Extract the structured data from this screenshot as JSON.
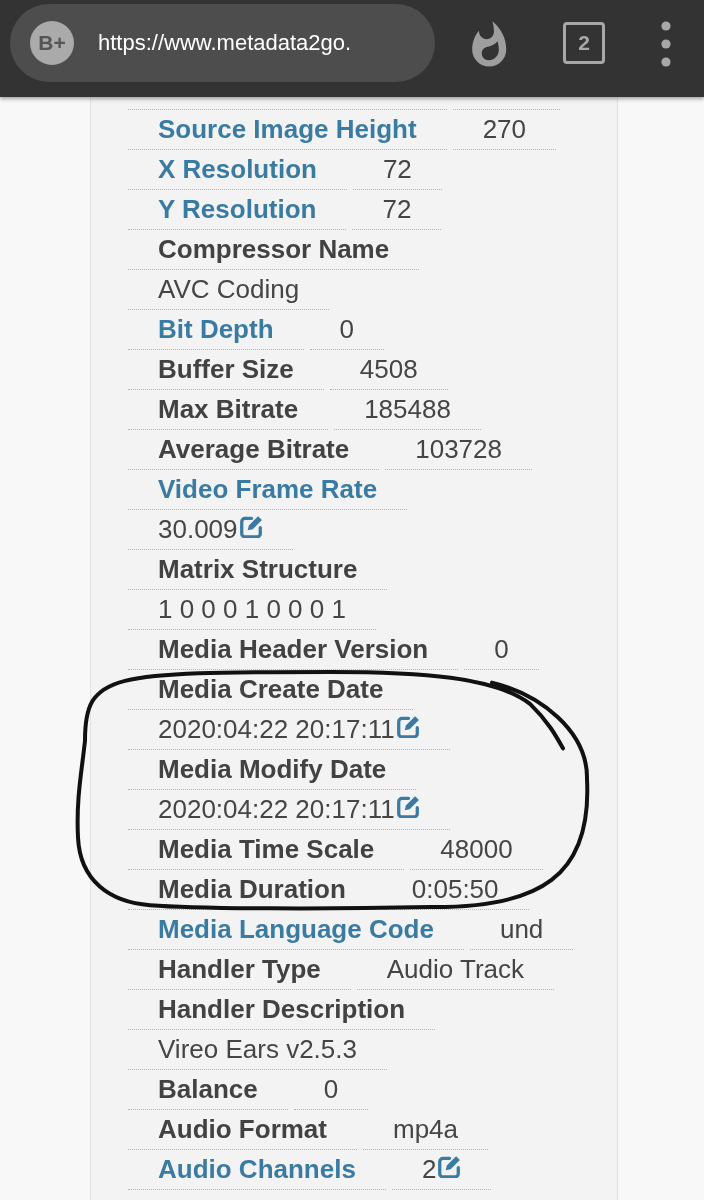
{
  "browser_bar": {
    "site_badge": "B+",
    "url": "https://www.metadata2go.",
    "tab_count": "2"
  },
  "metadata": [
    {
      "label": "Source Image Height",
      "linked": true,
      "kind": "inline",
      "value": "270",
      "editable": false,
      "circled": false
    },
    {
      "label": "X Resolution",
      "linked": true,
      "kind": "inline",
      "value": "72",
      "editable": false,
      "circled": false
    },
    {
      "label": "Y Resolution",
      "linked": true,
      "kind": "inline",
      "value": "72",
      "editable": false,
      "circled": false
    },
    {
      "label": "Compressor Name",
      "linked": false,
      "kind": "stacked",
      "value": "AVC Coding",
      "editable": false,
      "circled": false
    },
    {
      "label": "Bit Depth",
      "linked": true,
      "kind": "inline",
      "value": "0",
      "editable": false,
      "circled": false
    },
    {
      "label": "Buffer Size",
      "linked": false,
      "kind": "inline",
      "value": "4508",
      "editable": false,
      "circled": false
    },
    {
      "label": "Max Bitrate",
      "linked": false,
      "kind": "inline",
      "value": "185488",
      "editable": false,
      "circled": false
    },
    {
      "label": "Average Bitrate",
      "linked": false,
      "kind": "inline",
      "value": "103728",
      "editable": false,
      "circled": false
    },
    {
      "label": "Video Frame Rate",
      "linked": true,
      "kind": "stacked",
      "value": "30.009",
      "editable": true,
      "circled": false
    },
    {
      "label": "Matrix Structure",
      "linked": false,
      "kind": "stacked",
      "value": "1 0 0 0 1 0 0 0 1",
      "editable": false,
      "circled": false
    },
    {
      "label": "Media Header Version",
      "linked": false,
      "kind": "inline",
      "value": "0",
      "editable": false,
      "circled": false
    },
    {
      "label": "Media Create Date",
      "linked": false,
      "kind": "stacked",
      "value": "2020:04:22 20:17:11",
      "editable": true,
      "circled": true
    },
    {
      "label": "Media Modify Date",
      "linked": false,
      "kind": "stacked",
      "value": "2020:04:22 20:17:11",
      "editable": true,
      "circled": true
    },
    {
      "label": "Media Time Scale",
      "linked": false,
      "kind": "inline",
      "value": "48000",
      "editable": false,
      "circled": true
    },
    {
      "label": "Media Duration",
      "linked": false,
      "kind": "inline",
      "value": "0:05:50",
      "editable": false,
      "circled": true
    },
    {
      "label": "Media Language Code",
      "linked": true,
      "kind": "inline",
      "value": "und",
      "editable": false,
      "circled": false
    },
    {
      "label": "Handler Type",
      "linked": false,
      "kind": "inline",
      "value": "Audio Track",
      "editable": false,
      "circled": false
    },
    {
      "label": "Handler Description",
      "linked": false,
      "kind": "stacked",
      "value": "Vireo Ears v2.5.3",
      "editable": false,
      "circled": false
    },
    {
      "label": "Balance",
      "linked": false,
      "kind": "inline",
      "value": "0",
      "editable": false,
      "circled": false
    },
    {
      "label": "Audio Format",
      "linked": false,
      "kind": "inline",
      "value": "mp4a",
      "editable": false,
      "circled": false
    },
    {
      "label": "Audio Channels",
      "linked": true,
      "kind": "inline",
      "value": "2",
      "editable": true,
      "circled": false
    }
  ]
}
